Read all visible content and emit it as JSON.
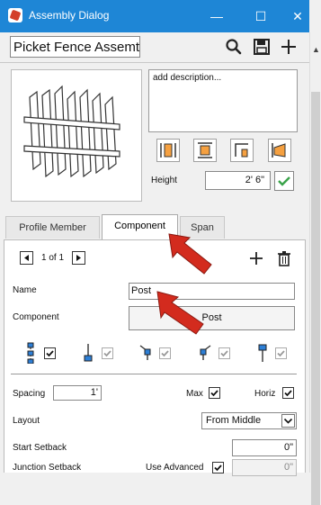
{
  "window": {
    "title": "Assembly Dialog",
    "minimize": "—",
    "maximize": "☐",
    "close": "✕"
  },
  "assembly": {
    "name_value": "Picket Fence Assemt"
  },
  "description": {
    "text": "add description..."
  },
  "height": {
    "label": "Height",
    "value": "2' 6\""
  },
  "tabs": [
    {
      "label": "Profile Member"
    },
    {
      "label": "Component"
    },
    {
      "label": "Span"
    }
  ],
  "pager": {
    "text": "1 of 1"
  },
  "component": {
    "name_label": "Name",
    "name_value": "Post",
    "component_label": "Component",
    "component_button": "Post"
  },
  "spacing": {
    "label": "Spacing",
    "value": "1'",
    "max_label": "Max",
    "horiz_label": "Horiz"
  },
  "layout": {
    "label": "Layout",
    "value": "From Middle"
  },
  "start_setback": {
    "label": "Start Setback",
    "value": "0\""
  },
  "junction_setback": {
    "label": "Junction Setback",
    "use_advanced_label": "Use Advanced",
    "value": "0\""
  },
  "colors": {
    "titlebar": "#1e86d6",
    "check_green": "#3aa34a",
    "arrow_red": "#d32b1e"
  }
}
